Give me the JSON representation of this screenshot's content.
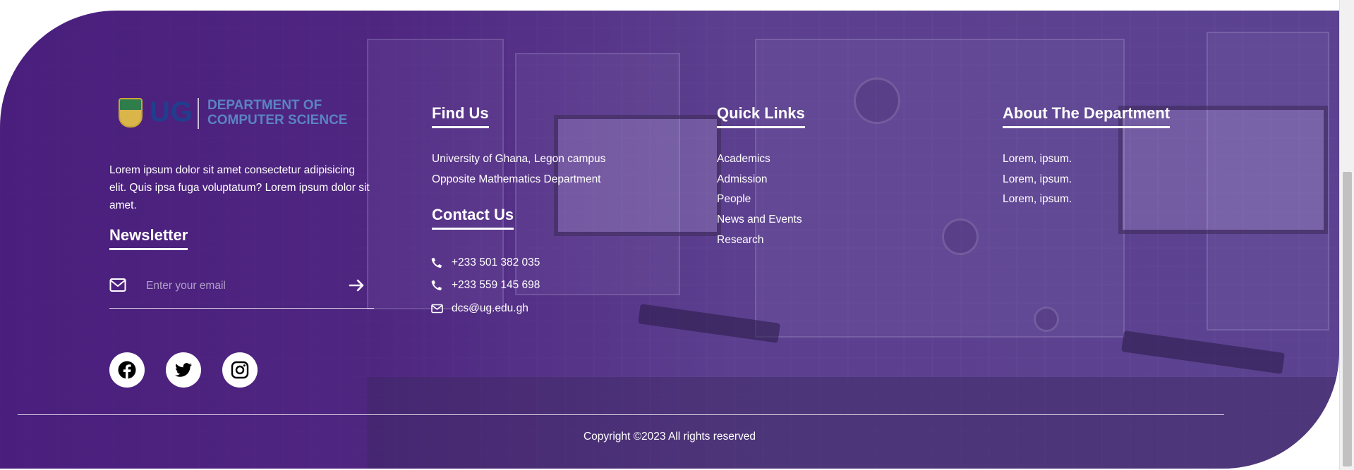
{
  "brand": {
    "logo_ug": "UG",
    "logo_dept": "DEPARTMENT OF COMPUTER SCIENCE",
    "about_text": "Lorem ipsum dolor sit amet consectetur adipisicing elit. Quis ipsa fuga voluptatum? Lorem ipsum dolor sit amet."
  },
  "newsletter": {
    "heading": "Newsletter",
    "placeholder": "Enter your email",
    "submit_icon": "arrow-right-icon"
  },
  "social": [
    {
      "name": "facebook-icon"
    },
    {
      "name": "twitter-icon"
    },
    {
      "name": "instagram-icon"
    }
  ],
  "find_us": {
    "heading": "Find Us",
    "lines": [
      "University of Ghana, Legon campus",
      "Opposite Mathematics Department"
    ]
  },
  "contact": {
    "heading": "Contact Us",
    "items": [
      {
        "icon": "phone-icon",
        "text": "+233 501 382 035"
      },
      {
        "icon": "phone-icon",
        "text": "+233 559 145 698"
      },
      {
        "icon": "envelope-icon",
        "text": "dcs@ug.edu.gh"
      }
    ]
  },
  "quick_links": {
    "heading": "Quick Links",
    "items": [
      "Academics",
      "Admission",
      "People",
      "News and Events",
      "Research"
    ]
  },
  "about_dept": {
    "heading": "About The Department",
    "items": [
      "Lorem, ipsum.",
      "Lorem, ipsum.",
      "Lorem, ipsum."
    ]
  },
  "copyright": "Copyright ©2023 All rights reserved",
  "colors": {
    "footer_purple": "#4a2a7e",
    "text": "#ffffff",
    "logo_blue": "#1f3f8e"
  }
}
